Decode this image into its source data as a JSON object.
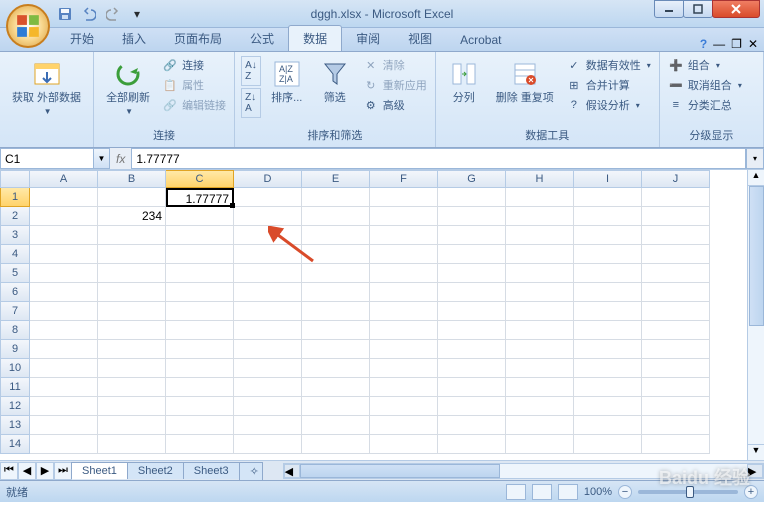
{
  "title": "dggh.xlsx - Microsoft Excel",
  "tabs": [
    "开始",
    "插入",
    "页面布局",
    "公式",
    "数据",
    "审阅",
    "视图",
    "Acrobat"
  ],
  "active_tab_index": 4,
  "ribbon": {
    "g1": {
      "btn": "获取\n外部数据",
      "label": ""
    },
    "g2": {
      "btn": "全部刷新",
      "s1": "连接",
      "s2": "属性",
      "s3": "编辑链接",
      "label": "连接"
    },
    "g3": {
      "b1": "排序...",
      "b2": "筛选",
      "s1": "清除",
      "s2": "重新应用",
      "s3": "高级",
      "label": "排序和筛选"
    },
    "g4": {
      "b1": "分列",
      "b2": "删除\n重复项",
      "s1": "数据有效性",
      "s2": "合并计算",
      "s3": "假设分析",
      "label": "数据工具"
    },
    "g5": {
      "s1": "组合",
      "s2": "取消组合",
      "s3": "分类汇总",
      "label": "分级显示"
    }
  },
  "namebox": "C1",
  "formula": "1.77777",
  "columns": [
    "A",
    "B",
    "C",
    "D",
    "E",
    "F",
    "G",
    "H",
    "I",
    "J"
  ],
  "selected_col_index": 2,
  "selected_row_index": 0,
  "row_count": 14,
  "cells": {
    "C1": "1.77777",
    "B2": "234"
  },
  "sheets": [
    "Sheet1",
    "Sheet2",
    "Sheet3"
  ],
  "active_sheet": 0,
  "status": "就绪",
  "zoom": "100%",
  "watermark": "Baidu 经验"
}
